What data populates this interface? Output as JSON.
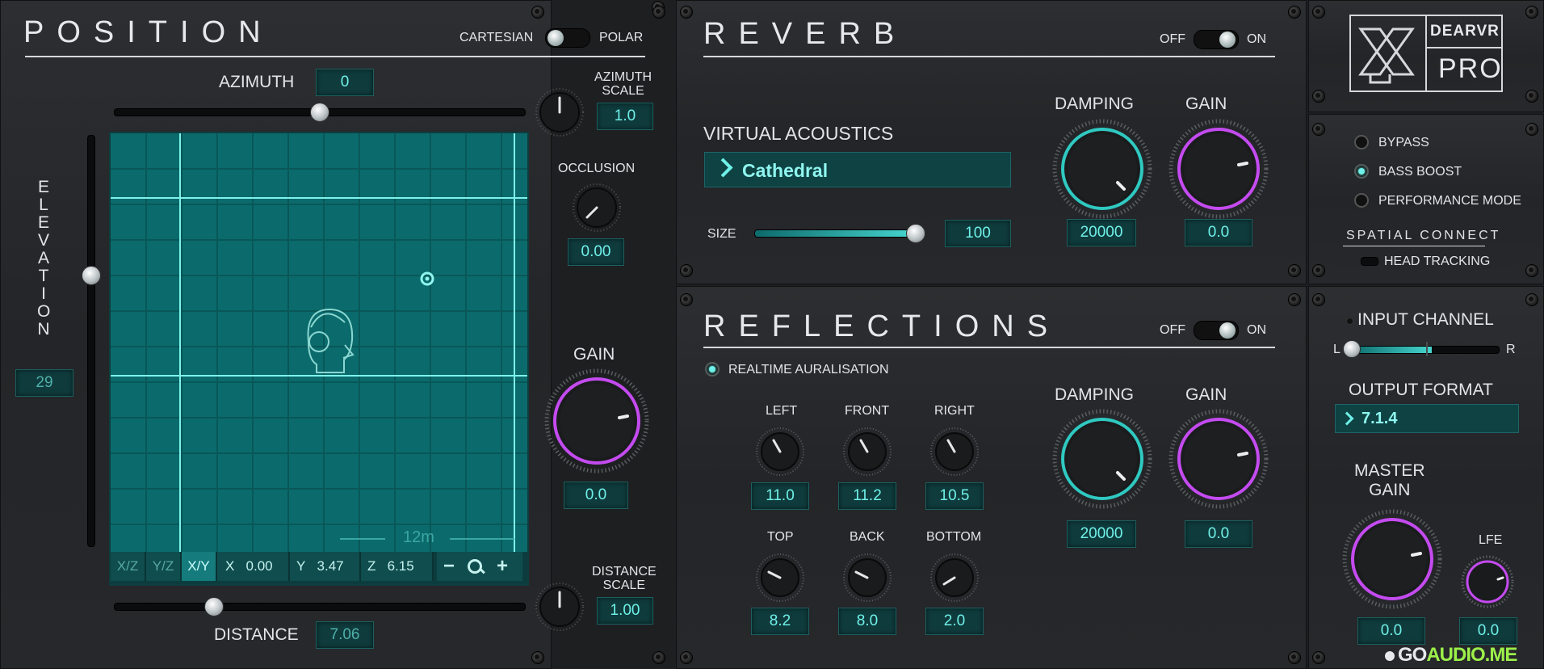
{
  "position": {
    "title": "POSITION",
    "mode_left": "CARTESIAN",
    "mode_right": "POLAR",
    "azimuth_label": "AZIMUTH",
    "azimuth_value": "0",
    "azimuth_scale_label_1": "AZIMUTH",
    "azimuth_scale_label_2": "SCALE",
    "azimuth_scale_value": "1.0",
    "occlusion_label": "OCCLUSION",
    "occlusion_value": "0.00",
    "gain_label": "GAIN",
    "gain_value": "0.0",
    "elevation_label": [
      "E",
      "L",
      "E",
      "V",
      "A",
      "T",
      "I",
      "O",
      "N"
    ],
    "elevation_value": "29",
    "grid_distance_label": "12m",
    "view_buttons": [
      "X/Z",
      "Y/Z",
      "X/Y"
    ],
    "x_label": "X",
    "x_value": "0.00",
    "y_label": "Y",
    "y_value": "3.47",
    "z_label": "Z",
    "z_value": "6.15",
    "zoom_minus": "−",
    "zoom_plus": "+",
    "distance_label": "DISTANCE",
    "distance_value": "7.06",
    "distance_scale_label_1": "DISTANCE",
    "distance_scale_label_2": "SCALE",
    "distance_scale_value": "1.00"
  },
  "reverb": {
    "title": "REVERB",
    "off": "OFF",
    "on": "ON",
    "va_label": "VIRTUAL ACOUSTICS",
    "preset": "Cathedral",
    "size_label": "SIZE",
    "size_value": "100",
    "damping_label": "DAMPING",
    "damping_value": "20000",
    "gain_label": "GAIN",
    "gain_value": "0.0"
  },
  "reflections": {
    "title": "REFLECTIONS",
    "off": "OFF",
    "on": "ON",
    "realtime_label": "REALTIME AURALISATION",
    "left_label": "LEFT",
    "left_value": "11.0",
    "front_label": "FRONT",
    "front_value": "11.2",
    "right_label": "RIGHT",
    "right_value": "10.5",
    "top_label": "TOP",
    "top_value": "8.2",
    "back_label": "BACK",
    "back_value": "8.0",
    "bottom_label": "BOTTOM",
    "bottom_value": "2.0",
    "damping_label": "DAMPING",
    "damping_value": "20000",
    "gain_label": "GAIN",
    "gain_value": "0.0"
  },
  "brand": {
    "top": "DEARVR",
    "bottom": "PRO"
  },
  "options": {
    "bypass": "BYPASS",
    "bass_boost": "BASS BOOST",
    "performance": "PERFORMANCE MODE",
    "spatial_connect": "SPATIAL CONNECT",
    "head_tracking": "HEAD TRACKING"
  },
  "output": {
    "input_channel": "INPUT CHANNEL",
    "l": "L",
    "r": "R",
    "output_format_label": "OUTPUT FORMAT",
    "output_format": "7.1.4",
    "master_gain_1": "MASTER",
    "master_gain_2": "GAIN",
    "master_gain_value": "0.0",
    "lfe_label": "LFE",
    "lfe_value": "0.0"
  },
  "watermark": "GOAUDIO.ME",
  "colors": {
    "teal": "#6ff0e8",
    "purple": "#c44bf0",
    "grid": "#0b6b6c"
  }
}
